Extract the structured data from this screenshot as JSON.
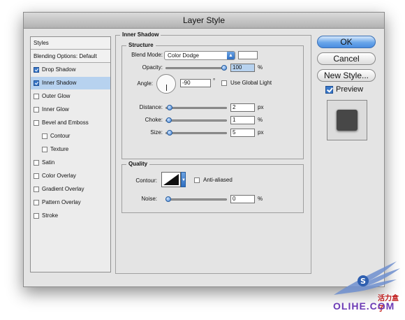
{
  "window": {
    "title": "Layer Style"
  },
  "styles_panel": {
    "header": "Styles",
    "blending": "Blending Options: Default",
    "items": [
      {
        "label": "Drop Shadow",
        "checked": true,
        "indent": false,
        "selected": false
      },
      {
        "label": "Inner Shadow",
        "checked": true,
        "indent": false,
        "selected": true
      },
      {
        "label": "Outer Glow",
        "checked": false,
        "indent": false,
        "selected": false
      },
      {
        "label": "Inner Glow",
        "checked": false,
        "indent": false,
        "selected": false
      },
      {
        "label": "Bevel and Emboss",
        "checked": false,
        "indent": false,
        "selected": false
      },
      {
        "label": "Contour",
        "checked": false,
        "indent": true,
        "selected": false
      },
      {
        "label": "Texture",
        "checked": false,
        "indent": true,
        "selected": false
      },
      {
        "label": "Satin",
        "checked": false,
        "indent": false,
        "selected": false
      },
      {
        "label": "Color Overlay",
        "checked": false,
        "indent": false,
        "selected": false
      },
      {
        "label": "Gradient Overlay",
        "checked": false,
        "indent": false,
        "selected": false
      },
      {
        "label": "Pattern Overlay",
        "checked": false,
        "indent": false,
        "selected": false
      },
      {
        "label": "Stroke",
        "checked": false,
        "indent": false,
        "selected": false
      }
    ]
  },
  "inner_shadow": {
    "section_title": "Inner Shadow",
    "structure": {
      "title": "Structure",
      "blend_mode_label": "Blend Mode:",
      "blend_mode_value": "Color Dodge",
      "blend_color": "#ffffff",
      "opacity_label": "Opacity:",
      "opacity_value": "100",
      "opacity_unit": "%",
      "opacity_level": 1.0,
      "angle_label": "Angle:",
      "angle_value": "-90",
      "angle_unit": "°",
      "global_light_label": "Use Global Light",
      "global_light_checked": false,
      "distance_label": "Distance:",
      "distance_value": "2",
      "distance_unit": "px",
      "distance_level": 0.02,
      "choke_label": "Choke:",
      "choke_value": "1",
      "choke_unit": "%",
      "choke_level": 0.01,
      "size_label": "Size:",
      "size_value": "5",
      "size_unit": "px",
      "size_level": 0.02
    },
    "quality": {
      "title": "Quality",
      "contour_label": "Contour:",
      "anti_aliased_label": "Anti-aliased",
      "anti_aliased_checked": false,
      "noise_label": "Noise:",
      "noise_value": "0",
      "noise_unit": "%",
      "noise_level": 0.0
    }
  },
  "buttons": {
    "ok": "OK",
    "cancel": "Cancel",
    "new_style": "New Style...",
    "preview_label": "Preview",
    "preview_checked": true
  },
  "watermark": {
    "line1": "活力盒子",
    "line2": "OLIHE.COM"
  }
}
